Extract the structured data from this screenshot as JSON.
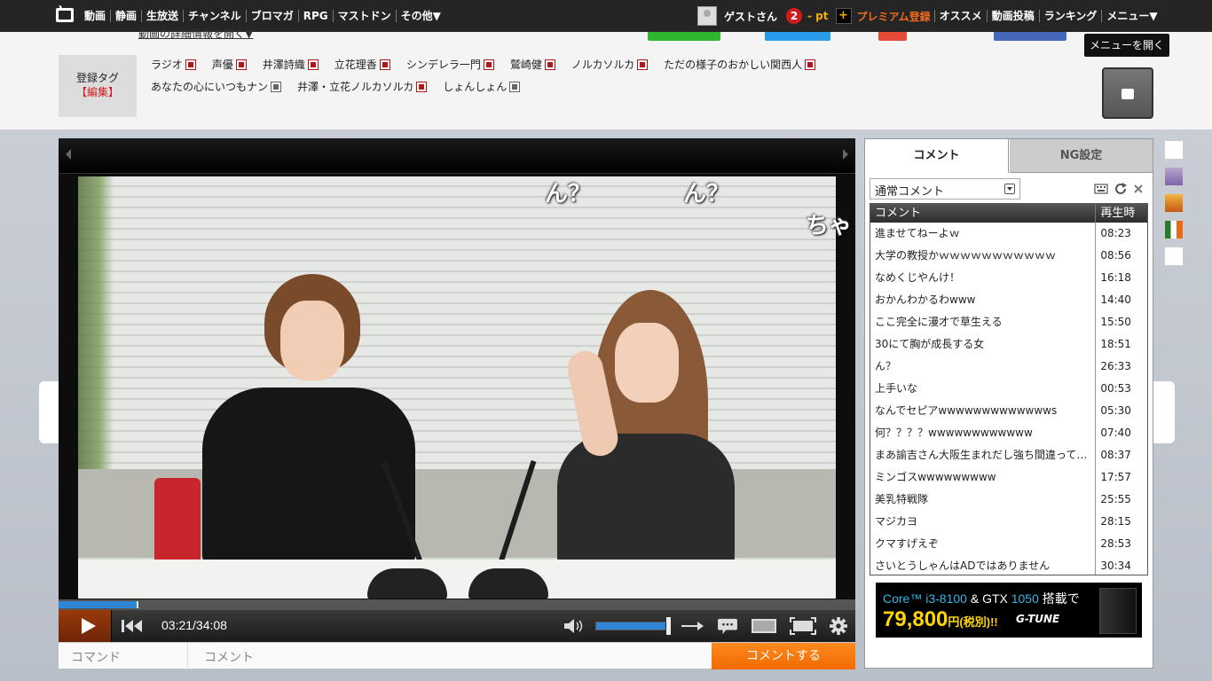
{
  "topbar": {
    "nav": [
      "動画",
      "静画",
      "生放送",
      "チャンネル",
      "ブロマガ",
      "RPG",
      "マストドン",
      "その他▼"
    ],
    "user": "ゲストさん",
    "points_badge": "2",
    "points_label": "- pt",
    "premium_icon": "+",
    "premium_label": "プレミアム登録",
    "right_nav": [
      "オススメ",
      "動画投稿",
      "ランキング",
      "メニュー▼"
    ]
  },
  "header": {
    "detail_link": "動画の詳細情報を開く▼",
    "tag_label": "登録タグ",
    "tag_edit": "【編集】",
    "tags_row1": [
      "ラジオ",
      "声優",
      "井澤詩織",
      "立花理香",
      "シンデレラ一門",
      "鷲崎健",
      "ノルカソルカ",
      "ただの様子のおかしい関西人"
    ],
    "tags_row2": [
      "あなたの心にいつもナン",
      "井澤・立花ノルカソルカ",
      "しょんしょん"
    ],
    "menu_tooltip": "メニューを開く"
  },
  "player": {
    "floating_comments": [
      "ん？",
      "ん？",
      "ちゃ"
    ],
    "time": "03:21/34:08",
    "progress_fraction": 0.098,
    "volume_fraction": 0.95,
    "command_placeholder": "コマンド",
    "comment_placeholder": "コメント",
    "submit_label": "コメントする"
  },
  "panel": {
    "tab_comment": "コメント",
    "tab_ng": "NG設定",
    "comment_type": "通常コメント",
    "col_comment": "コメント",
    "col_time": "再生時",
    "comments": [
      {
        "text": "進ませてねーよｗ",
        "time": "08:23"
      },
      {
        "text": "大学の教授かｗｗｗｗｗｗｗｗｗｗｗ",
        "time": "08:56"
      },
      {
        "text": "なめくじやんけ！",
        "time": "16:18"
      },
      {
        "text": "おかんわかるわwww",
        "time": "14:40"
      },
      {
        "text": "ここ完全に漫才で草生える",
        "time": "15:50"
      },
      {
        "text": "30にて胸が成長する女",
        "time": "18:51"
      },
      {
        "text": "ん？",
        "time": "26:33"
      },
      {
        "text": "上手いな",
        "time": "00:53"
      },
      {
        "text": "なんでセピアwwwwwwwwwwwwws",
        "time": "05:30"
      },
      {
        "text": "何？？？？wwwwwwwwwwww",
        "time": "07:40"
      },
      {
        "text": "まあ諭吉さん大阪生まれだし強ち間違ってないなwww",
        "time": "08:37"
      },
      {
        "text": "ミンゴスwwwwwwwww",
        "time": "17:57"
      },
      {
        "text": "美乳特戦隊",
        "time": "25:55"
      },
      {
        "text": "マジカヨ",
        "time": "28:15"
      },
      {
        "text": "クマすげえぞ",
        "time": "28:53"
      },
      {
        "text": "さいとうしゃんはADではありません",
        "time": "30:34"
      }
    ],
    "ad": {
      "cpu": "Core™ i3-8100",
      "and": " & ",
      "gpu_prefix": "GTX ",
      "gpu_num": "1050",
      "suffix": " 搭載で",
      "price": "79,800",
      "price_suffix": "円(税別)!!",
      "brand": "G-TUNE"
    }
  }
}
